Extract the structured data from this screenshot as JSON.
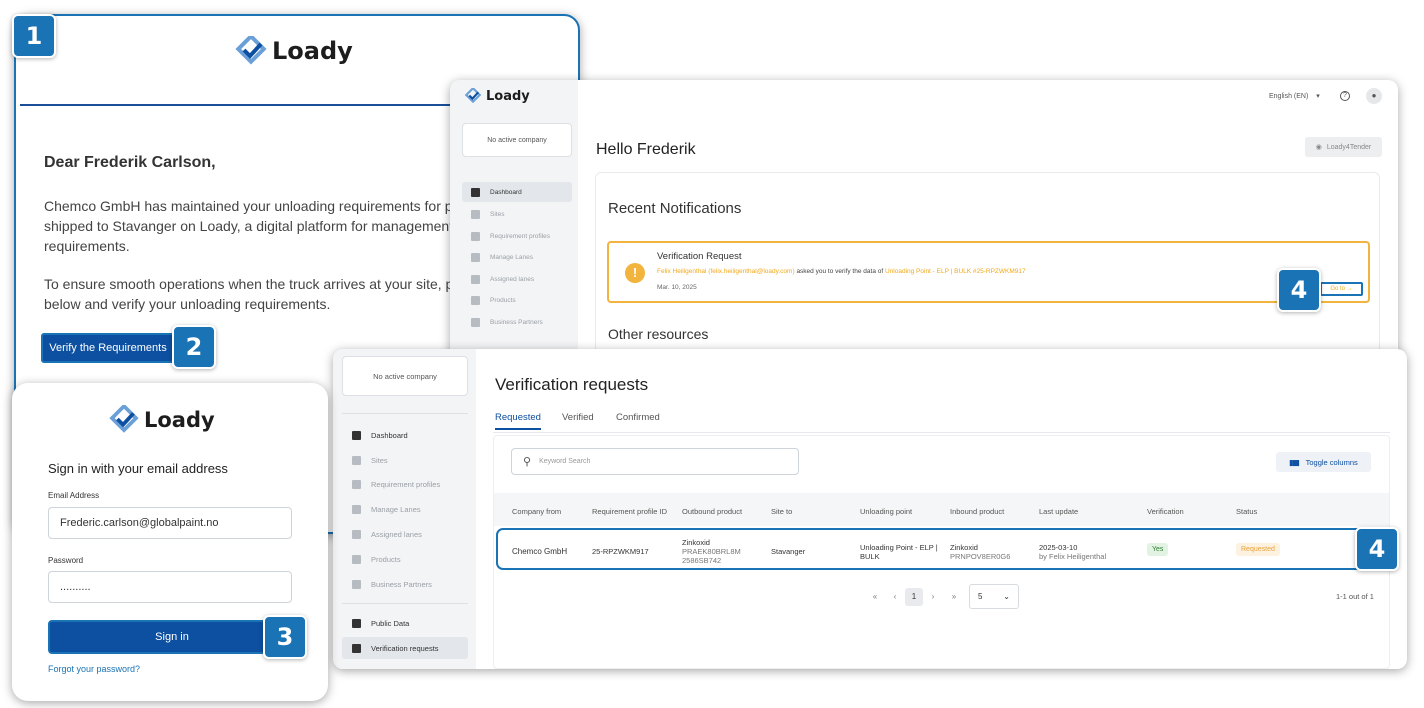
{
  "brand": {
    "name": "Loady",
    "accent": "#1a73b5",
    "blue": "#0d4fa0"
  },
  "steps": [
    "1",
    "2",
    "3",
    "4",
    "4"
  ],
  "email": {
    "greeting": "Dear Frederik Carlson,",
    "para1_line1": "Chemco GmbH has maintained your unloading requirements for pro",
    "para1_line2": "shipped to Stavanger on Loady, a digital platform for management o",
    "para1_line3": "requirements.",
    "para2_line1": "To ensure smooth operations when the truck arrives at your site, ple",
    "para2_line2": "below and verify your unloading requirements.",
    "verify_button": "Verify the Requirements"
  },
  "dashboard": {
    "language": "English (EN)",
    "no_company": "No active company",
    "sidebar": [
      "Dashboard",
      "Sites",
      "Requirement profiles",
      "Manage Lanes",
      "Assigned lanes",
      "Products",
      "Business Partners"
    ],
    "greeting": "Hello Frederik",
    "tender_button": "Loady4Tender",
    "recent_title": "Recent Notifications",
    "notif_title": "Verification Request",
    "notif_sender": "Felix Heiligenthal (felix.heiligenthal@loady.com)",
    "notif_mid": "asked you to verify the data of",
    "notif_link": "Unloading Point - ELP | BULK #25-RPZWKM917",
    "notif_date": "Mar. 10, 2025",
    "goto_button": "Go to →",
    "other_title": "Other resources"
  },
  "signin": {
    "title": "Sign in with your email address",
    "email_label": "Email Address",
    "email_value": "Frederic.carlson@globalpaint.no",
    "password_label": "Password",
    "password_value": "..........",
    "signin_button": "Sign in",
    "forgot": "Forgot your password?"
  },
  "verification": {
    "no_company": "No active company",
    "sidebar": [
      "Dashboard",
      "Sites",
      "Requirement profiles",
      "Manage Lanes",
      "Assigned lanes",
      "Products",
      "Business Partners"
    ],
    "sidebar2": [
      "Public Data",
      "Verification requests"
    ],
    "title": "Verification requests",
    "tabs": [
      "Requested",
      "Verified",
      "Confirmed"
    ],
    "search_placeholder": "Keyword Search",
    "toggle_columns": "Toggle columns",
    "columns": [
      "Company from",
      "Requirement profile ID",
      "Outbound product",
      "Site to",
      "Unloading point",
      "Inbound product",
      "Last update",
      "Verification",
      "Status"
    ],
    "row": {
      "company": "Chemco GmbH",
      "profile_id": "25-RPZWKM917",
      "outbound_1": "Zinkoxid",
      "outbound_2": "PRAEK80BRL8M",
      "outbound_3": "2586SB742",
      "site": "Stavanger",
      "unloading_1": "Unloading Point - ELP |",
      "unloading_2": "BULK",
      "inbound_1": "Zinkoxid",
      "inbound_2": "PRNPOV8ER0G6",
      "update_1": "2025-03-10",
      "update_2": "by Felix Heiligenthal",
      "verification": "Yes",
      "status": "Requested"
    },
    "pagination": {
      "first": "«",
      "prev": "‹",
      "page": "1",
      "next": "›",
      "last": "»",
      "per_page": "5",
      "count": "1-1 out of 1"
    }
  }
}
